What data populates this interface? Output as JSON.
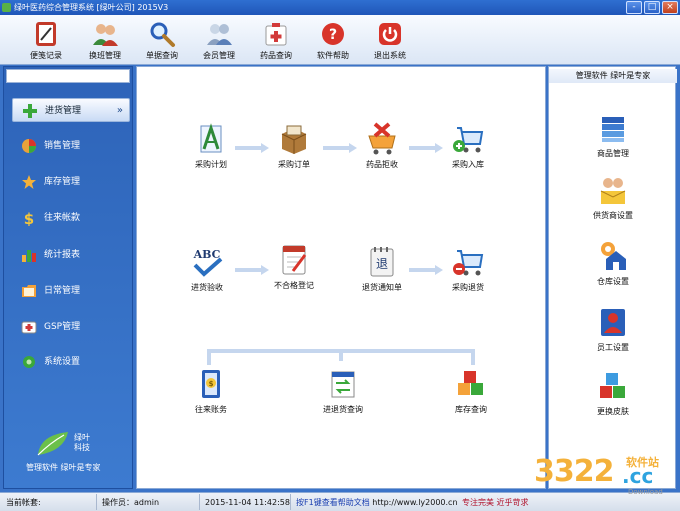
{
  "window": {
    "title": "绿叶医药综合管理系统 [绿叶公司] 2015V3",
    "controls": [
      "-",
      "□",
      "×"
    ]
  },
  "toolbar": {
    "buttons": [
      {
        "label": "便笺记录",
        "icon": "notepad-icon",
        "color": "#c23a2a"
      },
      {
        "label": "换班管理",
        "icon": "users-icon",
        "color": "#3b8a3a"
      },
      {
        "label": "单据查询",
        "icon": "search-icon",
        "color": "#2a5fb8"
      },
      {
        "label": "会员管理",
        "icon": "member-icon",
        "color": "#5a7fb8"
      },
      {
        "label": "药品查询",
        "icon": "medicine-kit-icon",
        "color": "#d23a3a"
      },
      {
        "label": "软件帮助",
        "icon": "help-icon",
        "color": "#d8342a"
      },
      {
        "label": "退出系统",
        "icon": "power-icon",
        "color": "#d8342a"
      }
    ]
  },
  "sidebar": {
    "items": [
      {
        "label": "进货管理",
        "icon": "plus-icon",
        "active": true
      },
      {
        "label": "销售管理",
        "icon": "pie-chart-icon",
        "active": false
      },
      {
        "label": "库存管理",
        "icon": "star-icon",
        "active": false
      },
      {
        "label": "往来帐款",
        "icon": "dollar-icon",
        "active": false
      },
      {
        "label": "统计报表",
        "icon": "bar-chart-icon",
        "active": false
      },
      {
        "label": "日常管理",
        "icon": "folder-icon",
        "active": false
      },
      {
        "label": "GSP管理",
        "icon": "gsp-icon",
        "active": false
      },
      {
        "label": "系统设置",
        "icon": "gear-icon",
        "active": false
      }
    ],
    "active_chevron": "»",
    "logo_text_line1": "绿叶",
    "logo_text_line2": "科技",
    "slogan": "管理软件  绿叶是专家"
  },
  "main": {
    "row1": [
      {
        "label": "采购计划",
        "icon": "plan-document-icon"
      },
      {
        "label": "采购订单",
        "icon": "order-box-icon"
      },
      {
        "label": "药品拒收",
        "icon": "reject-cart-icon"
      },
      {
        "label": "采购入库",
        "icon": "cart-in-icon"
      }
    ],
    "row2": [
      {
        "label": "进货验收",
        "icon": "abc-check-icon"
      },
      {
        "label": "不合格登记",
        "icon": "notebook-pencil-icon"
      },
      {
        "label": "退货通知单",
        "icon": "return-notice-icon"
      },
      {
        "label": "采购退货",
        "icon": "cart-out-icon"
      }
    ],
    "row3": [
      {
        "label": "往来账务",
        "icon": "account-book-icon"
      },
      {
        "label": "进退货查询",
        "icon": "exchange-query-icon"
      },
      {
        "label": "库存查询",
        "icon": "stock-cubes-icon"
      }
    ]
  },
  "right_panel": {
    "title": "管理软件  绿叶是专家",
    "items": [
      {
        "label": "商品管理",
        "icon": "product-books-icon"
      },
      {
        "label": "供货商设置",
        "icon": "supplier-icon"
      },
      {
        "label": "仓库设置",
        "icon": "warehouse-icon"
      },
      {
        "label": "员工设置",
        "icon": "employee-icon"
      },
      {
        "label": "更换皮肤",
        "icon": "skin-cubes-icon"
      }
    ]
  },
  "statusbar": {
    "account_label": "当前帐套:",
    "operator_label": "操作员：admin",
    "datetime": "2015-11-04 11:42:58",
    "help_hint": "按F1键查看帮助文档",
    "url": "http://www.ly2000.cn/",
    "motto": "专注完美  近乎苛求"
  },
  "watermark": {
    "number": "3322",
    "domain": ".cc",
    "soft": "软件站",
    "download": "Download"
  },
  "colors": {
    "nav_bg": "#3d7bd0",
    "title_bg": "#1f56b8",
    "arrow": "#c5d6ee"
  }
}
